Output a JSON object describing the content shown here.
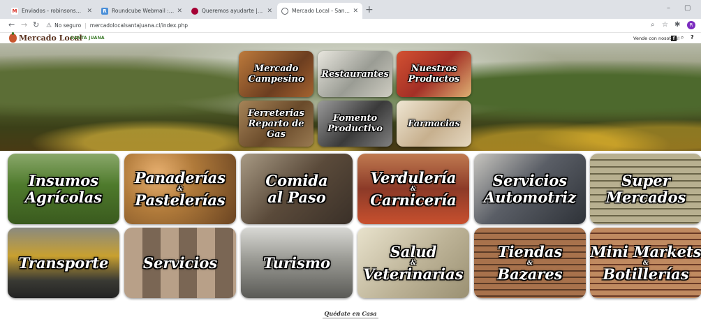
{
  "browser": {
    "tabs": [
      {
        "title": "Enviados - robinsonsandoval@g",
        "favicon_letter": "M",
        "favicon_color": "#d93025"
      },
      {
        "title": "Roundcube Webmail :: Bienvenid",
        "favicon_letter": "R",
        "favicon_color": "#4a8fd8"
      },
      {
        "title": "Queremos ayudarte | LG España",
        "favicon_letter": "",
        "favicon_color": "#a50034"
      },
      {
        "title": "Mercado Local - Santa Juana",
        "favicon_letter": "",
        "favicon_color": "#5f6368"
      }
    ],
    "new_tab": "+",
    "tab_close": "✕",
    "window_minimize": "–",
    "window_maximize": "▢",
    "address_warning": "No seguro",
    "url": "mercadolocalsantajuana.cl/index.php",
    "profile_initial": "R"
  },
  "site": {
    "logo_text": "Mercado Local",
    "logo_sub": "SANTA JUANA",
    "nav_link": "Vende con nosotros!",
    "icons": [
      "facebook-icon",
      "search-icon",
      "help-icon"
    ]
  },
  "hero_tiles": [
    {
      "label": "Mercado Campesino",
      "color": "#8a5a2e"
    },
    {
      "label": "Restaurantes",
      "color": "#b6b8b0"
    },
    {
      "label": "Nuestros Productos",
      "color": "#c43c2c"
    },
    {
      "label": "Ferreterias Reparto de Gas",
      "color": "#8a6840"
    },
    {
      "label": "Fomento Productivo",
      "color": "#6a6a6a"
    },
    {
      "label": "Farmacias",
      "color": "#d4c2a8"
    }
  ],
  "categories": [
    {
      "line1": "Insumos",
      "line2": "Agrícolas",
      "connector": "",
      "color": "#4e7a2c"
    },
    {
      "line1": "Panaderías",
      "line2": "Pastelerías",
      "connector": "&",
      "color": "#b07a3a"
    },
    {
      "line1": "Comida",
      "line2": "al Paso",
      "connector": "",
      "color": "#6a5a4a"
    },
    {
      "line1": "Verdulería",
      "line2": "Carnicería",
      "connector": "&",
      "color": "#9c4a30"
    },
    {
      "line1": "Servicios",
      "line2": "Automotriz",
      "connector": "",
      "color": "#5a5e66"
    },
    {
      "line1": "Super",
      "line2": "Mercados",
      "connector": "",
      "color": "#8a8a6a"
    },
    {
      "line1": "Transporte",
      "line2": "",
      "connector": "",
      "color": "#5a5a4e"
    },
    {
      "line1": "Servicios",
      "line2": "",
      "connector": "",
      "color": "#8c7a68"
    },
    {
      "line1": "Turismo",
      "line2": "",
      "connector": "",
      "color": "#8e8e8a"
    },
    {
      "line1": "Salud",
      "line2": "Veterinarias",
      "connector": "&",
      "color": "#c9c0a6"
    },
    {
      "line1": "Tiendas",
      "line2": "Bazares",
      "connector": "&",
      "color": "#7a5238"
    },
    {
      "line1": "Mini Markets",
      "line2": "Botillerías",
      "connector": "&",
      "color": "#8c5a40"
    }
  ],
  "footer": {
    "title": "Quédate en Casa"
  }
}
